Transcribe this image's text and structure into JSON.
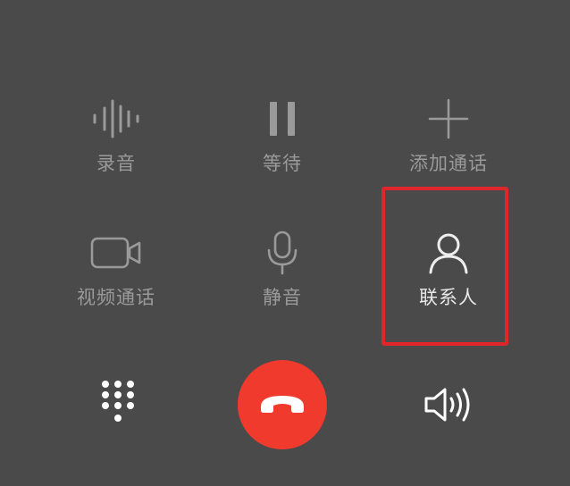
{
  "call_controls": {
    "record": {
      "label": "录音",
      "icon": "waveform-icon"
    },
    "hold": {
      "label": "等待",
      "icon": "pause-icon"
    },
    "add_call": {
      "label": "添加通话",
      "icon": "plus-icon"
    },
    "video_call": {
      "label": "视频通话",
      "icon": "video-camera-icon"
    },
    "mute": {
      "label": "静音",
      "icon": "microphone-icon"
    },
    "contacts": {
      "label": "联系人",
      "icon": "person-icon"
    }
  },
  "bottom_bar": {
    "keypad": {
      "icon": "dialpad-icon"
    },
    "hangup": {
      "icon": "end-call-icon",
      "color": "#f03a2e"
    },
    "speaker": {
      "icon": "speaker-icon"
    }
  },
  "colors": {
    "background": "#4a4a4a",
    "inactive_label": "#9a9a9a",
    "active_label": "#e8e8e8",
    "highlight": "#e0262a"
  }
}
